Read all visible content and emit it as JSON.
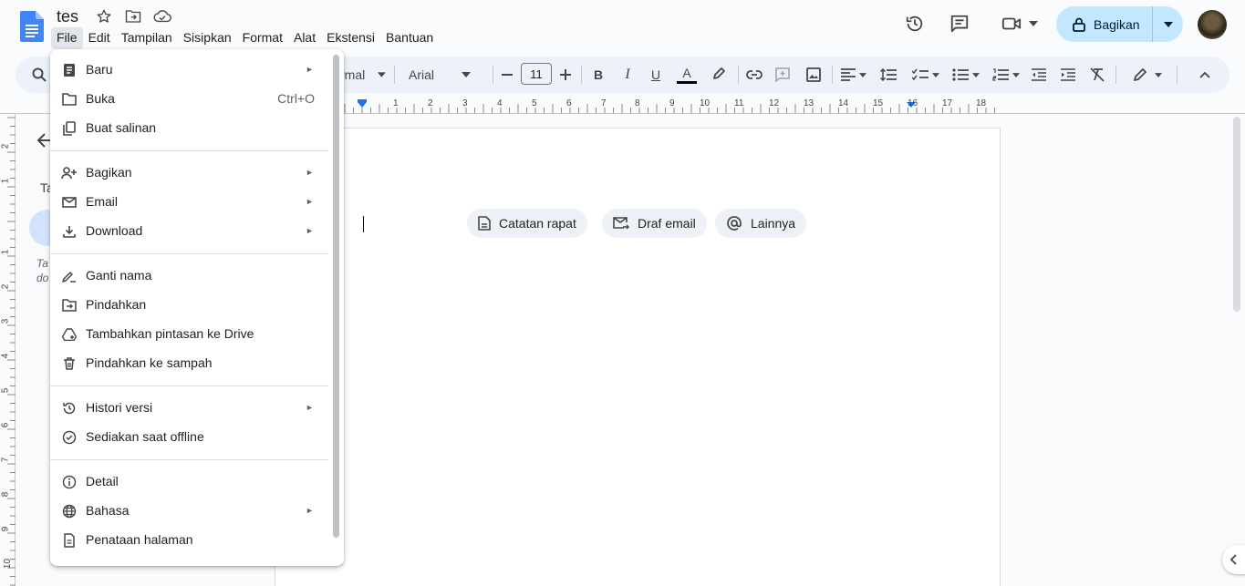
{
  "doc": {
    "title": "tes"
  },
  "menubar": [
    "File",
    "Edit",
    "Tampilan",
    "Sisipkan",
    "Format",
    "Alat",
    "Ekstensi",
    "Bantuan"
  ],
  "share": {
    "label": "Bagikan"
  },
  "toolbar": {
    "style_partial": "rmal",
    "font": "Arial",
    "font_size": "11"
  },
  "ruler": {
    "top": [
      "1",
      "1",
      "2",
      "3",
      "4",
      "5",
      "6",
      "7",
      "8",
      "9",
      "10",
      "11",
      "12",
      "13",
      "14",
      "15",
      "16",
      "17",
      "18"
    ],
    "left": [
      "2",
      "1",
      "1",
      "2",
      "3",
      "4",
      "5",
      "6",
      "7",
      "8",
      "9",
      "10"
    ]
  },
  "outline": {
    "heading_partial": "Ta",
    "note_partial": [
      "Ta",
      "do"
    ]
  },
  "chips": [
    {
      "label": "Catatan rapat",
      "icon": "document-icon"
    },
    {
      "label": "Draf email",
      "icon": "mail-forward-icon"
    },
    {
      "label": "Lainnya",
      "icon": "at-sign-icon"
    }
  ],
  "file_menu": {
    "items": [
      {
        "label": "Baru",
        "icon": "new-document-icon",
        "submenu": true
      },
      {
        "label": "Buka",
        "icon": "folder-icon",
        "shortcut": "Ctrl+O"
      },
      {
        "label": "Buat salinan",
        "icon": "copy-icon"
      },
      {
        "label": "Bagikan",
        "icon": "person-add-icon",
        "submenu": true
      },
      {
        "label": "Email",
        "icon": "mail-icon",
        "submenu": true
      },
      {
        "label": "Download",
        "icon": "download-icon",
        "submenu": true
      },
      {
        "label": "Ganti nama",
        "icon": "rename-icon"
      },
      {
        "label": "Pindahkan",
        "icon": "move-folder-icon"
      },
      {
        "label": "Tambahkan pintasan ke Drive",
        "icon": "drive-shortcut-icon"
      },
      {
        "label": "Pindahkan ke sampah",
        "icon": "trash-icon"
      },
      {
        "label": "Histori versi",
        "icon": "history-icon",
        "submenu": true
      },
      {
        "label": "Sediakan saat offline",
        "icon": "offline-icon"
      },
      {
        "label": "Detail",
        "icon": "info-icon"
      },
      {
        "label": "Bahasa",
        "icon": "globe-icon",
        "submenu": true
      },
      {
        "label": "Penataan halaman",
        "icon": "page-setup-icon"
      }
    ],
    "submenu_arrow": "►"
  },
  "colors": {
    "accent": "#1a73e8",
    "share_bg": "#c2e7ff",
    "toolbar_bg": "#edf2fa",
    "docs_blue": "#4285f4"
  }
}
